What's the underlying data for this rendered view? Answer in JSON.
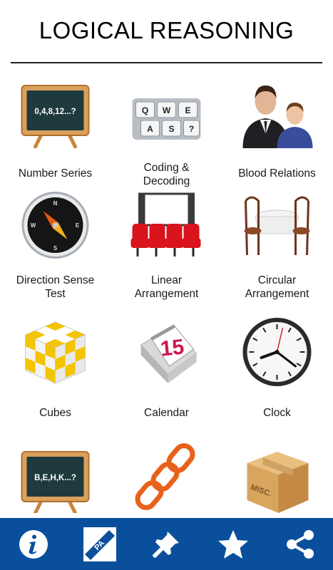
{
  "header": {
    "title": "LOGICAL REASONING"
  },
  "topics": [
    {
      "label": "Number Series",
      "icon": "chalkboard-number-series-icon",
      "board_text": "0,4,8,12...?"
    },
    {
      "label": "Coding &\nDecoding",
      "icon": "keyboard-keys-icon",
      "keys": [
        "Q",
        "W",
        "E",
        "A",
        "S",
        "?"
      ]
    },
    {
      "label": "Blood Relations",
      "icon": "family-people-icon"
    },
    {
      "label": "Direction Sense\nTest",
      "icon": "compass-icon",
      "compass": [
        "N",
        "E",
        "S",
        "W"
      ]
    },
    {
      "label": "Linear\nArrangement",
      "icon": "theater-seats-icon"
    },
    {
      "label": "Circular\nArrangement",
      "icon": "round-table-chairs-icon"
    },
    {
      "label": "Cubes",
      "icon": "checkered-cube-icon"
    },
    {
      "label": "Calendar",
      "icon": "desk-calendar-icon",
      "calendar_day": "15"
    },
    {
      "label": "Clock",
      "icon": "wall-clock-icon"
    },
    {
      "label": "",
      "icon": "chalkboard-letter-series-icon",
      "board_text": "B,E,H,K...?"
    },
    {
      "label": "",
      "icon": "chain-links-icon"
    },
    {
      "label": "",
      "icon": "cardboard-box-icon",
      "box_text": "MISC."
    }
  ],
  "tabbar": {
    "background": "#0a4f9c",
    "tabs": [
      {
        "name": "info",
        "icon": "info-icon"
      },
      {
        "name": "practice-aptitude",
        "icon": "pa-app-logo-icon",
        "badge_text": "PA"
      },
      {
        "name": "pin",
        "icon": "pin-icon"
      },
      {
        "name": "favorites",
        "icon": "star-icon"
      },
      {
        "name": "share",
        "icon": "share-icon"
      }
    ]
  }
}
